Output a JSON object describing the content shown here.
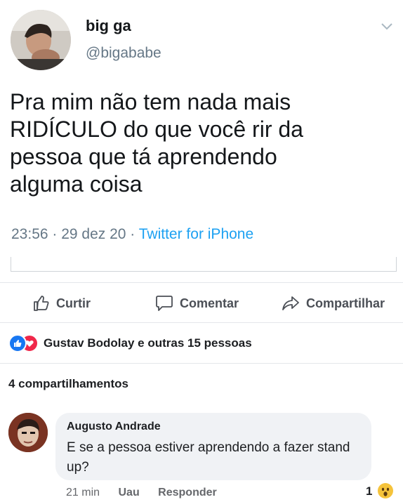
{
  "tweet": {
    "name": "big ga",
    "handle": "@bigababe",
    "text_line1": "Pra mim não tem nada mais",
    "text_line2": "RIDÍCULO do que você rir da",
    "text_line3": "pessoa que tá aprendendo",
    "text_line4": "alguma coisa",
    "time_date": "23:56 · 29 dez 20 · ",
    "source": "Twitter for iPhone",
    "icons": {
      "menu": "chevron-down-icon"
    }
  },
  "post": {
    "actions": {
      "like": "Curtir",
      "comment": "Comentar",
      "share": "Compartilhar"
    },
    "reactions_text": "Gustav Bodolay e outras 15 pessoas",
    "shares_text": "4 compartilhamentos",
    "colors": {
      "like": "#1877f2",
      "love": "#f0284a"
    }
  },
  "comment": {
    "author": "Augusto Andrade",
    "text": "E se a pessoa estiver aprendendo a fazer stand up?",
    "time": "21 min",
    "reaction_link": "Uau",
    "reply": "Responder",
    "reaction_count": "1"
  }
}
